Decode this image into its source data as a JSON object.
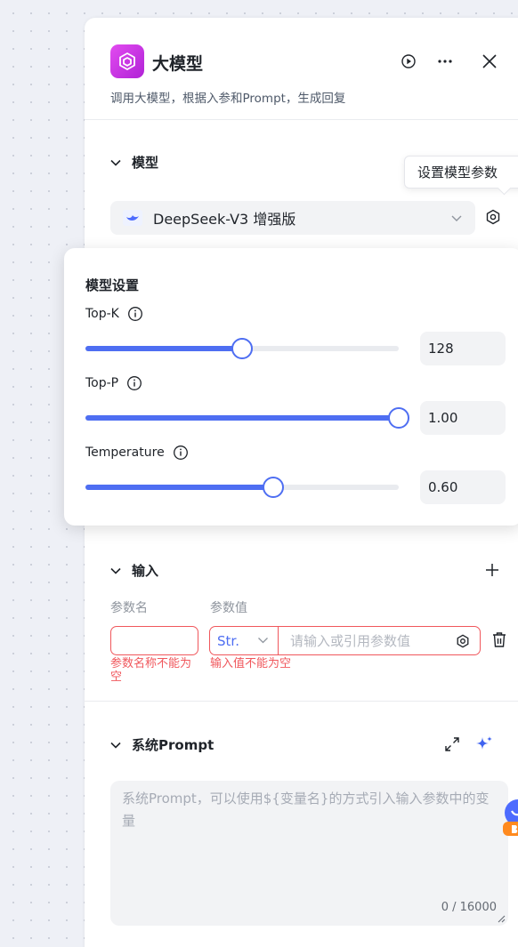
{
  "header": {
    "title": "大模型",
    "description": "调用大模型，根据入参和Prompt，生成回复"
  },
  "model_section": {
    "title": "模型",
    "tooltip": "设置模型参数",
    "selected_model": "DeepSeek-V3 增强版"
  },
  "model_settings": {
    "title": "模型设置",
    "params": [
      {
        "label": "Top-K",
        "value": "128",
        "fraction": 0.5
      },
      {
        "label": "Top-P",
        "value": "1.00",
        "fraction": 1.0
      },
      {
        "label": "Temperature",
        "value": "0.60",
        "fraction": 0.6
      }
    ]
  },
  "input_section": {
    "title": "输入",
    "col_name": "参数名",
    "col_value": "参数值",
    "type_value": "Str.",
    "value_placeholder": "请输入或引用参数值",
    "name_error": "参数名称不能为空",
    "value_error": "输入值不能为空"
  },
  "system_prompt": {
    "title": "系统Prompt",
    "placeholder": "系统Prompt，可以使用${变量名}的方式引入输入参数中的变量",
    "counter": "0 / 16000"
  },
  "colors": {
    "accent": "#4e6ef2",
    "error": "#f0575c",
    "brand": "#c02fe0"
  }
}
